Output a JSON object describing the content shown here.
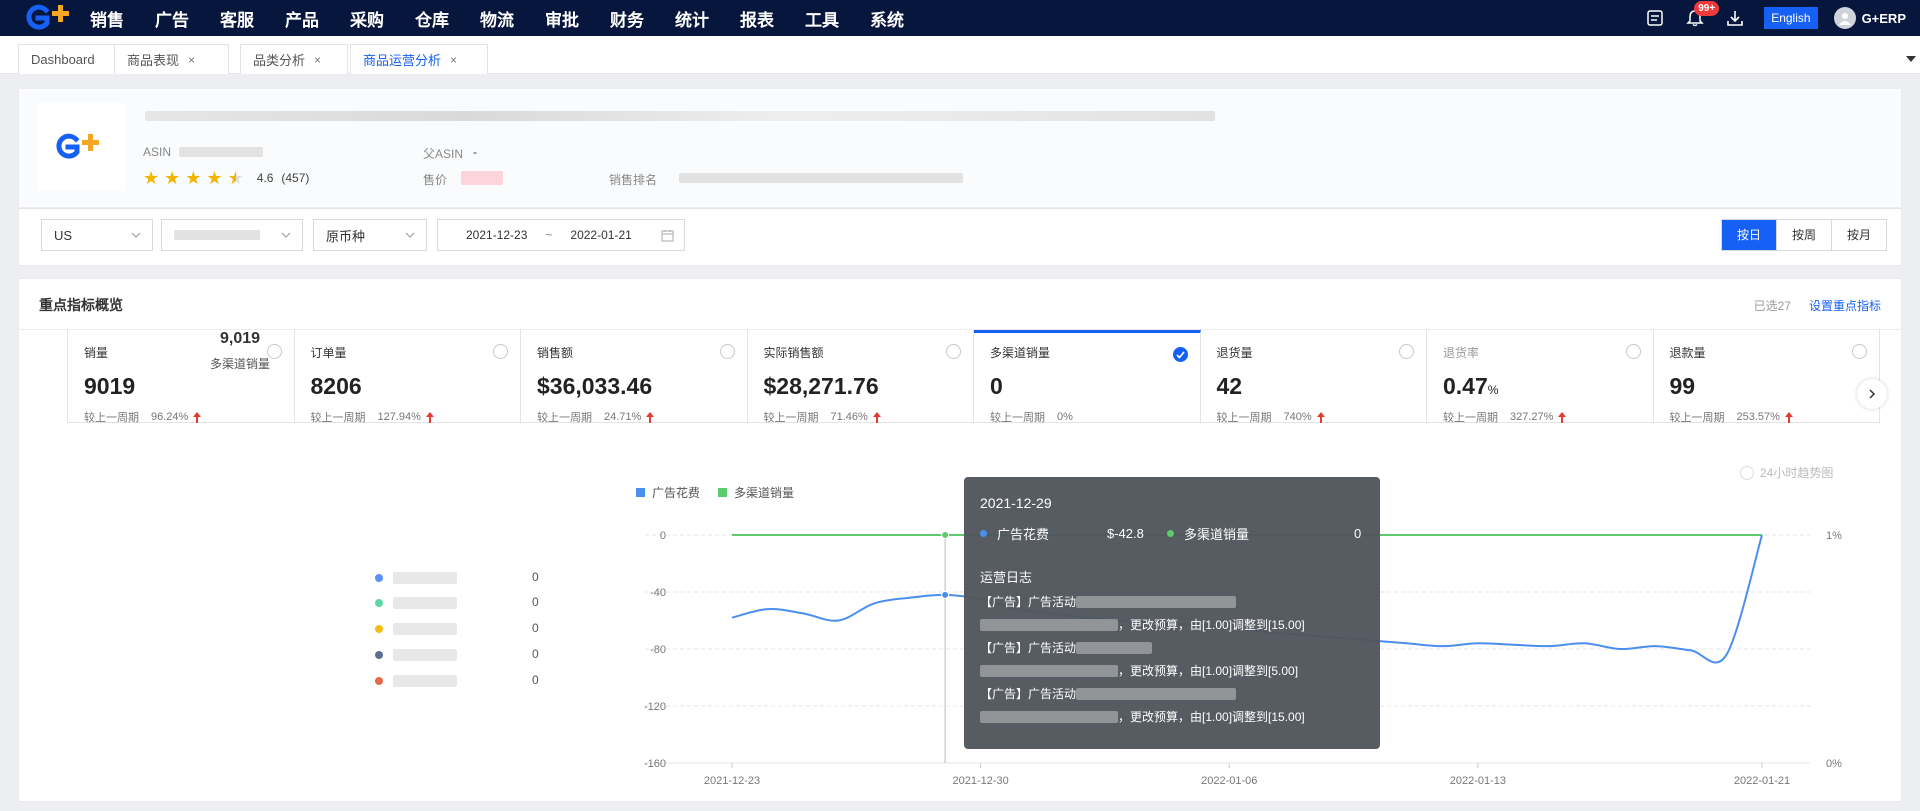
{
  "nav": {
    "menu": [
      "销售",
      "广告",
      "客服",
      "产品",
      "采购",
      "仓库",
      "物流",
      "审批",
      "财务",
      "统计",
      "报表",
      "工具",
      "系统"
    ],
    "notification_badge": "99+",
    "language": "English",
    "user_name": "G+ERP"
  },
  "tabs": [
    {
      "label": "Dashboard",
      "closable": false
    },
    {
      "label": "商品表现",
      "closable": true
    },
    {
      "label": "品类分析",
      "closable": true
    },
    {
      "label": "商品运营分析",
      "closable": true,
      "active": true
    }
  ],
  "tab_close": "×",
  "product": {
    "asin_label": "ASIN",
    "rating": "4.6",
    "reviews": "(457)",
    "star_count": 4.5,
    "parent_asin_label": "父ASIN",
    "parent_asin_value": "-",
    "price_label": "售价",
    "rank_label": "销售排名"
  },
  "filters": {
    "country": "US",
    "currency": "原币种",
    "date_start": "2021-12-23",
    "date_sep": "~",
    "date_end": "2022-01-21",
    "granularity": [
      "按日",
      "按周",
      "按月"
    ]
  },
  "overview": {
    "title": "重点指标概览",
    "selected_count": "已选27",
    "settings_link": "设置重点指标"
  },
  "kpis": [
    {
      "name": "销量",
      "value": "9019",
      "unit": "",
      "compare_label": "较上一周期",
      "pct": "96.24%"
    },
    {
      "name": "订单量",
      "value": "8206",
      "unit": "",
      "compare_label": "较上一周期",
      "pct": "127.94%"
    },
    {
      "name": "销售额",
      "value": "$36,033.46",
      "unit": "",
      "compare_label": "较上一周期",
      "pct": "24.71%"
    },
    {
      "name": "实际销售额",
      "value": "$28,271.76",
      "unit": "",
      "compare_label": "较上一周期",
      "pct": "71.46%"
    },
    {
      "name": "多渠道销量",
      "value": "0",
      "unit": "",
      "compare_label": "较上一周期",
      "pct": "0%",
      "selected": true
    },
    {
      "name": "退货量",
      "value": "42",
      "unit": "",
      "compare_label": "较上一周期",
      "pct": "740%"
    },
    {
      "name": "退货率",
      "value": "0.47",
      "unit": "%",
      "compare_label": "较上一周期",
      "pct": "327.27%"
    },
    {
      "name": "退款量",
      "value": "99",
      "unit": "",
      "compare_label": "较上一周期",
      "pct": "253.57%"
    }
  ],
  "donut": {
    "total": "9,019",
    "label": "多渠道销量",
    "legend_values": [
      "0",
      "0",
      "0",
      "0",
      "0"
    ],
    "legend_colors": [
      "#5b8ff9",
      "#5ad8a6",
      "#f6bd16",
      "#5d7092",
      "#e8684a"
    ]
  },
  "toggle_24h": "24小时趋势图",
  "chart_data": {
    "type": "line",
    "series": [
      {
        "name": "广告花费",
        "color": "#4a8ef0",
        "axis": "left",
        "values": [
          -58,
          -52,
          -55,
          -60,
          -48,
          -44,
          -42,
          -45,
          -52,
          -55,
          -58,
          -60,
          -62,
          -63,
          -65,
          -68,
          -70,
          -72,
          -74,
          -76,
          -78,
          -76,
          -77,
          -78,
          -76,
          -80,
          -78,
          -81,
          -84,
          0
        ]
      },
      {
        "name": "多渠道销量",
        "color": "#5ccb6e",
        "axis": "right",
        "values": [
          1,
          1,
          1,
          1,
          1,
          1,
          1,
          1,
          1,
          1,
          1,
          1,
          1,
          1,
          1,
          1,
          1,
          1,
          1,
          1,
          1,
          1,
          1,
          1,
          1,
          1,
          1,
          1,
          1,
          1
        ]
      }
    ],
    "x_ticks": [
      "2021-12-23",
      "2021-12-30",
      "2022-01-06",
      "2022-01-13",
      "2022-01-21"
    ],
    "y_left_ticks": [
      "0",
      "-40",
      "-80",
      "-120",
      "-160"
    ],
    "y_right_ticks": [
      "1%",
      "0%"
    ],
    "ylim": [
      -160,
      0
    ]
  },
  "tooltip": {
    "date": "2021-12-29",
    "series1_name": "广告花费",
    "series1_value": "$-42.8",
    "series2_name": "多渠道销量",
    "series2_value": "0",
    "log_title": "运营日志",
    "log_prefix": "【广告】广告活动",
    "log_lines": [
      "，更改预算，由[1.00]调整到[15.00]",
      "，更改预算，由[1.00]调整到[5.00]",
      "，更改预算，由[1.00]调整到[15.00]"
    ]
  }
}
